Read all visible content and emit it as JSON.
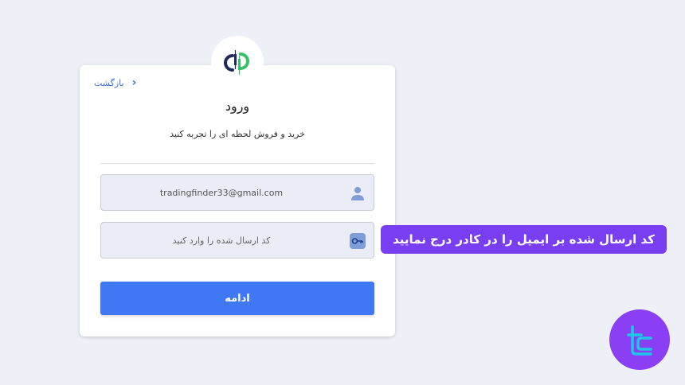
{
  "back": {
    "label": "بازگشت"
  },
  "title": "ورود",
  "subtitle": "خرید و فروش لحظه ای را تجربه کنید",
  "email_field": {
    "value": "tradingfinder33@gmail.com"
  },
  "code_field": {
    "placeholder": "کد ارسال شده را وارد کنید"
  },
  "continue_button": {
    "label": "ادامه"
  },
  "annotation": {
    "text": "کد ارسال شده بر ایمیل را در کادر درج نمایید"
  },
  "colors": {
    "accent": "#3f78f2",
    "annotation_bg": "#7a3ef2",
    "brand_bg": "#8a3ff5",
    "logo_green": "#35c26a",
    "logo_navy": "#1f2a5c"
  },
  "icons": {
    "logo": "exchange-logo-icon",
    "back": "chevron-left-icon",
    "email": "user-icon",
    "code": "key-icon",
    "brand": "tradingfinder-logo-icon"
  }
}
